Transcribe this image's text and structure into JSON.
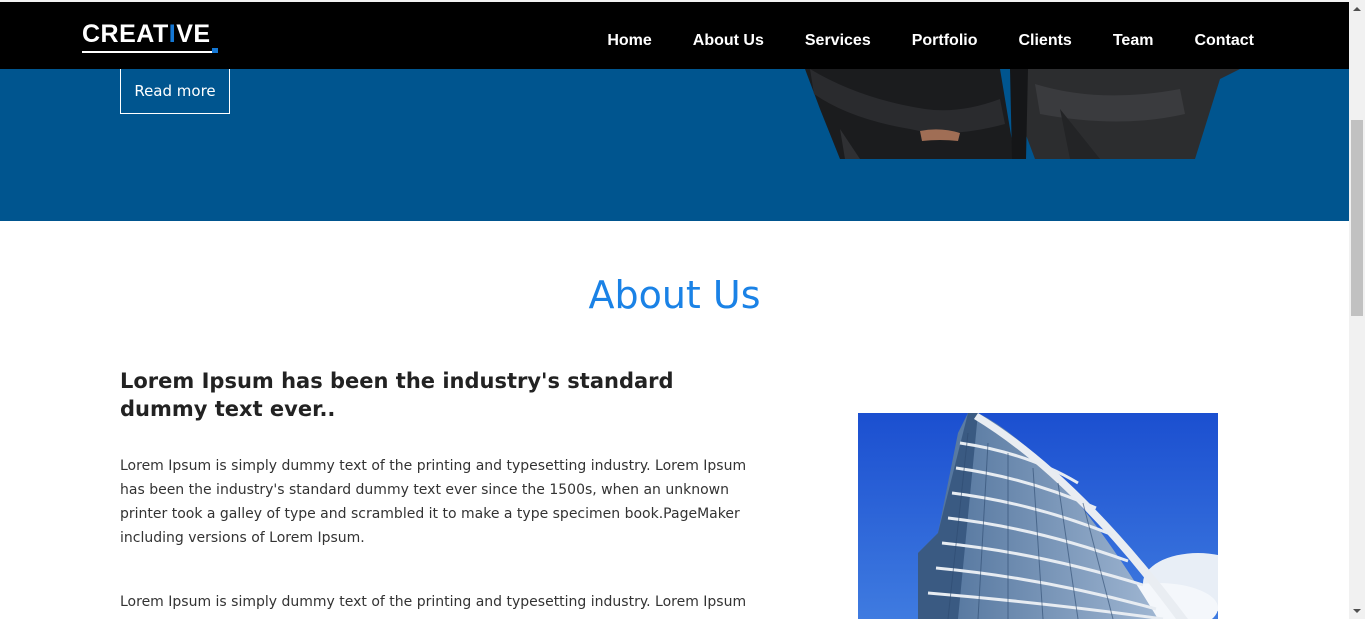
{
  "brand": {
    "logo_part1": "CREAT",
    "logo_part2": "I",
    "logo_part3": "VE",
    "accent_color": "#1477d4"
  },
  "nav": {
    "items": [
      {
        "label": "Home"
      },
      {
        "label": "About Us"
      },
      {
        "label": "Services"
      },
      {
        "label": "Portfolio"
      },
      {
        "label": "Clients"
      },
      {
        "label": "Team"
      },
      {
        "label": "Contact"
      }
    ]
  },
  "hero": {
    "read_more_label": "Read more",
    "background_color": "#00558f"
  },
  "about": {
    "title": "About Us",
    "title_color": "#1a82e6",
    "heading": "Lorem Ipsum has been the industry's standard dummy text ever..",
    "paragraph1": "Lorem Ipsum is simply dummy text of the printing and typesetting industry. Lorem Ipsum has been the industry's standard dummy text ever since the 1500s, when an unknown printer took a galley of type and scrambled it to make a type specimen book.PageMaker including versions of Lorem Ipsum.",
    "paragraph2": "Lorem Ipsum is simply dummy text of the printing and typesetting industry. Lorem Ipsum"
  },
  "icons": {
    "scroll_up": "chevron-up-icon",
    "scroll_down": "chevron-down-icon"
  }
}
